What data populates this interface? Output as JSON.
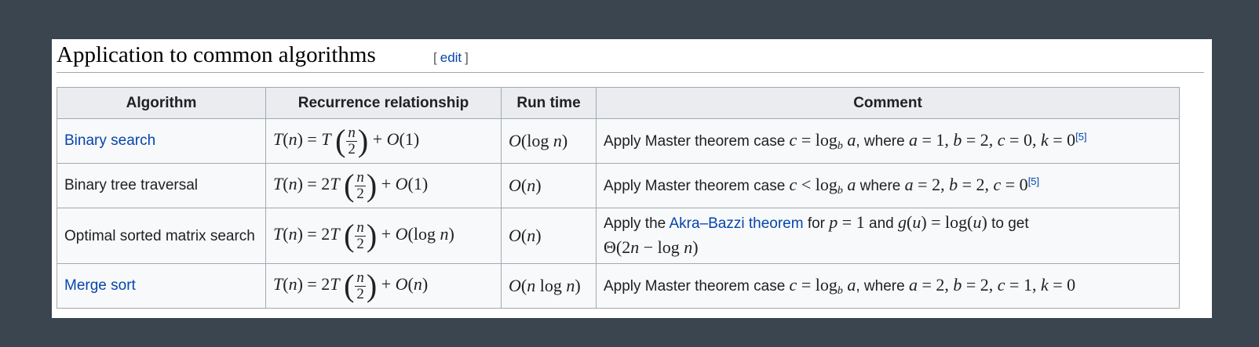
{
  "section": {
    "title": "Application to common algorithms",
    "edit_open": "[",
    "edit_label": "edit",
    "edit_close": "]"
  },
  "table": {
    "headers": [
      "Algorithm",
      "Recurrence relationship",
      "Run time",
      "Comment"
    ],
    "rows": [
      {
        "algorithm": "Binary search",
        "algorithm_is_link": true,
        "recurrence": "T(n) = T(n/2) + O(1)",
        "run_time": "O(log n)",
        "comment_pre": "Apply Master theorem case",
        "comment_mid": ", where",
        "ref": "[5]"
      },
      {
        "algorithm": "Binary tree traversal",
        "algorithm_is_link": false,
        "recurrence": "T(n) = 2T(n/2) + O(1)",
        "run_time": "O(n)",
        "comment_pre": "Apply Master theorem case",
        "comment_mid": "where",
        "ref": "[5]"
      },
      {
        "algorithm": "Optimal sorted matrix search",
        "algorithm_is_link": false,
        "recurrence": "T(n) = 2T(n/2) + O(log n)",
        "run_time": "O(n)",
        "comment_pre": "Apply the",
        "comment_link": "Akra–Bazzi theorem",
        "comment_for": "for",
        "comment_and": "and",
        "comment_to_get": "to get"
      },
      {
        "algorithm": "Merge sort",
        "algorithm_is_link": true,
        "recurrence": "T(n) = 2T(n/2) + O(n)",
        "run_time": "O(n log n)",
        "comment_pre": "Apply Master theorem case",
        "comment_mid": ", where"
      }
    ]
  },
  "colors": {
    "link": "#0645ad",
    "header_bg": "#eaecf0",
    "cell_bg": "#f8f9fa",
    "border": "#a2a9b1",
    "backdrop": "#3b4550"
  }
}
